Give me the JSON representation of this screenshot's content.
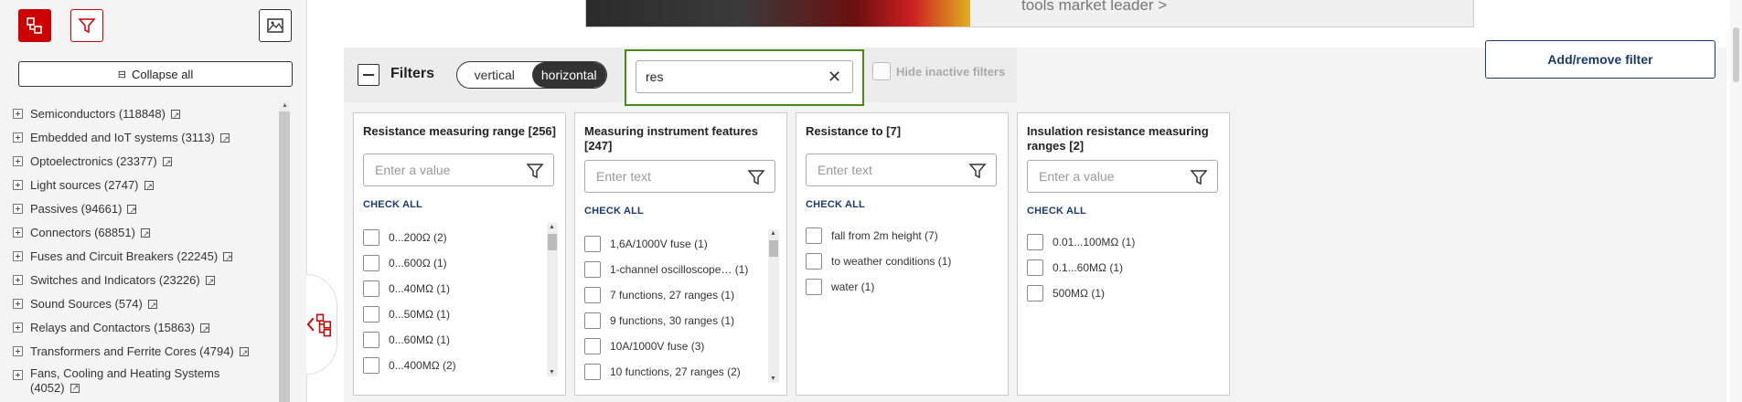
{
  "sidebar": {
    "collapse_all": "Collapse all",
    "categories": [
      {
        "label": "Semiconductors (118848)"
      },
      {
        "label": "Embedded and IoT systems (3113)"
      },
      {
        "label": "Optoelectronics (23377)"
      },
      {
        "label": "Light sources (2747)"
      },
      {
        "label": "Passives (94661)"
      },
      {
        "label": "Connectors (68851)"
      },
      {
        "label": "Fuses and Circuit Breakers (22245)"
      },
      {
        "label": "Switches and Indicators (23226)"
      },
      {
        "label": "Sound Sources (574)"
      },
      {
        "label": "Relays and Contactors (15863)"
      },
      {
        "label": "Transformers and Ferrite Cores (4794)"
      },
      {
        "label": "Fans, Cooling and Heating Systems (4052)"
      }
    ]
  },
  "banner": {
    "text": "tools market leader >"
  },
  "filters": {
    "title": "Filters",
    "view_options": [
      "vertical",
      "horizontal"
    ],
    "active_view": "horizontal",
    "search_value": "res",
    "clear_symbol": "✕",
    "hide_inactive": "Hide inactive filters",
    "add_remove": "Add/remove filter",
    "check_all": "CHECK ALL"
  },
  "cards": [
    {
      "title": "Resistance measuring range [256]",
      "placeholder": "Enter a value",
      "options": [
        "0...200Ω (2)",
        "0...600Ω (1)",
        "0...40MΩ (1)",
        "0...50MΩ (1)",
        "0...60MΩ (1)",
        "0...400MΩ (2)"
      ]
    },
    {
      "title": "Measuring instrument features [247]",
      "placeholder": "Enter text",
      "options": [
        "1,6A/1000V fuse (1)",
        "1-channel oscilloscope… (1)",
        "7 functions, 27 ranges (1)",
        "9 functions, 30 ranges (1)",
        "10A/1000V fuse (3)",
        "10 functions, 27 ranges (2)"
      ]
    },
    {
      "title": "Resistance to [7]",
      "placeholder": "Enter text",
      "options": [
        "fall from 2m height (7)",
        "to weather conditions (1)",
        "water (1)"
      ]
    },
    {
      "title": "Insulation resistance measuring ranges [2]",
      "placeholder": "Enter a value",
      "options": [
        "0.01...100MΩ (1)",
        "0.1...60MΩ (1)",
        "500MΩ (1)"
      ]
    }
  ],
  "colors": {
    "brand_red": "#cc0000",
    "active_green": "#4a8a1a",
    "link_blue": "#1a3a6a"
  },
  "icons": [
    "sidebar-tree-icon",
    "filter-icon",
    "image-icon",
    "collapse-icon",
    "external-link-icon",
    "funnel-icon",
    "tree-collapse-icon"
  ]
}
